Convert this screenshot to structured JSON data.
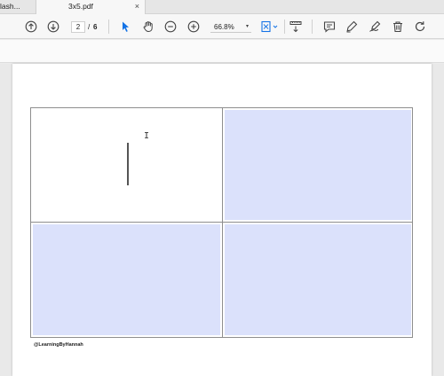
{
  "tabs": [
    {
      "label": "lash...",
      "active": false
    },
    {
      "label": "3x5.pdf",
      "active": true,
      "close_glyph": "×"
    }
  ],
  "toolbar": {
    "page_current": "2",
    "page_separator": "/",
    "page_total": "6",
    "zoom": "66.8%",
    "zoom_caret": "▾",
    "icons": [
      "arrow-up-circle-icon",
      "arrow-down-circle-icon",
      "select-arrow-icon",
      "hand-icon",
      "zoom-out-icon",
      "zoom-in-icon",
      "fit-page-icon",
      "measure-icon",
      "comment-icon",
      "pen-icon",
      "sign-icon",
      "trash-icon",
      "rotate-icon"
    ],
    "accent_color": "#1473e6"
  },
  "document": {
    "card_fill_color": "#dbe1fb",
    "ibeam_glyph": "I",
    "watermark": "@LearningByHannah"
  }
}
